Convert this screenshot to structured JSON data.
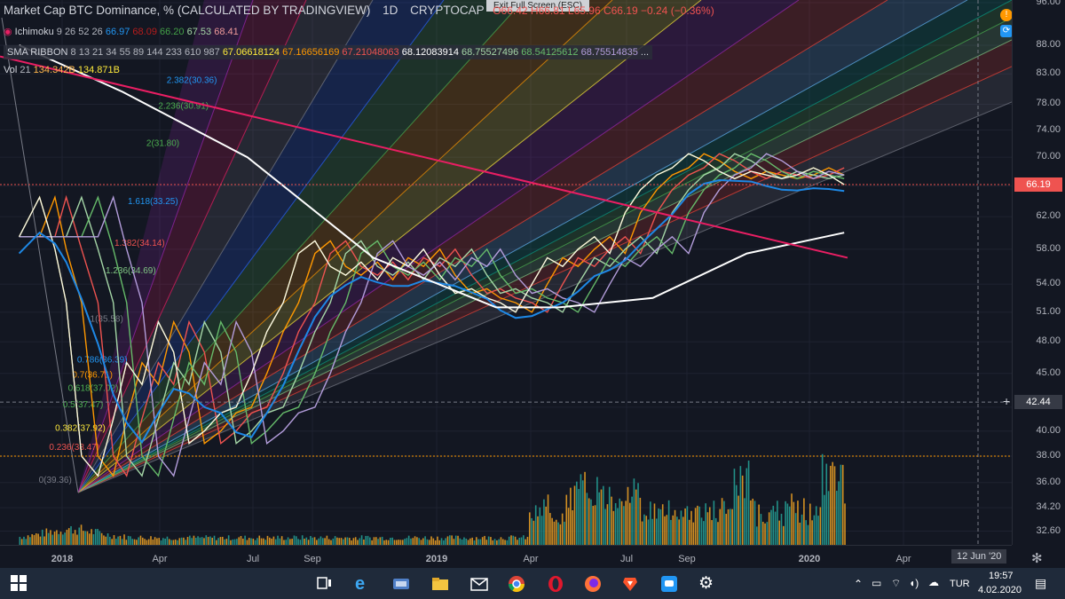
{
  "header": {
    "title": "Market Cap BTC Dominance, % (CALCULATED BY TRADINGVIEW)",
    "interval": "1D",
    "source": "CRYPTOCAP",
    "ohlc": "O66.42 H66.81 L65.96 C66.19 −0.24 (−0.36%)",
    "fullscreen_tip": "Exit Full Screen (ESC)"
  },
  "indicators": {
    "ichimoku_name": "Ichimoku",
    "ichimoku_params": "9 26 52 26",
    "ichimoku_values": [
      "66.97",
      "68.09",
      "66.20",
      "67.53",
      "68.41"
    ],
    "sma_name": "SMA RIBBON",
    "sma_params": "8 13 21 34 55 89 144 233 610 987",
    "sma_values": [
      "67.06618124",
      "67.16656169",
      "67.21048063",
      "68.12083914",
      "68.75527496",
      "68.54125612",
      "68.75514835"
    ],
    "sma_more": "...",
    "vol_name": "Vol",
    "vol_param": "21",
    "vol_values": [
      "134.342B",
      "134.871B"
    ]
  },
  "fib_labels": [
    {
      "text": "2.382(30.36)",
      "price": 81.5
    },
    {
      "text": "2.236(30.91)",
      "price": 77.3
    },
    {
      "text": "2(31.80)",
      "price": 71.6
    },
    {
      "text": "1.618(33.25)",
      "price": 63.6
    },
    {
      "text": "1.382(34.14)",
      "price": 58.4
    },
    {
      "text": "1.236(34.69)",
      "price": 55.2
    },
    {
      "text": "1(35.58)",
      "price": 50.0
    },
    {
      "text": "0.786(36.39)",
      "price": 46.0
    },
    {
      "text": "0.7(36.71)",
      "price": 44.6
    },
    {
      "text": "0.618(37.02)",
      "price": 43.4
    },
    {
      "text": "0.5(37.47)",
      "price": 42.0
    },
    {
      "text": "0.382(37.92)",
      "price": 40.0
    },
    {
      "text": "0.236(38.47)",
      "price": 38.5
    },
    {
      "text": "0(39.36)",
      "price": 36.0
    }
  ],
  "price_axis": {
    "ticks": [
      "96.00",
      "88.00",
      "83.00",
      "78.00",
      "74.00",
      "70.00",
      "66.00",
      "62.00",
      "58.00",
      "54.00",
      "51.00",
      "48.00",
      "45.00",
      "42.00",
      "40.00",
      "38.00",
      "36.00",
      "34.20",
      "32.60"
    ],
    "last_price": "66.19",
    "crosshair_price": "42.44",
    "last_color": "#ef5350",
    "crosshair_color": "#363a45"
  },
  "time_axis": {
    "ticks": [
      "2018",
      "Apr",
      "Jul",
      "Sep",
      "2019",
      "Apr",
      "Jul",
      "Sep",
      "2020",
      "Apr"
    ],
    "crosshair_date": "12 Jun '20"
  },
  "chart_data": {
    "type": "line",
    "title": "Market Cap BTC Dominance, % (CALCULATED BY TRADINGVIEW)",
    "x": [
      "2017-11-20",
      "2017-12-10",
      "2017-12-25",
      "2018-01-05",
      "2018-01-20",
      "2018-02-05",
      "2018-02-20",
      "2018-03-05",
      "2018-03-20",
      "2018-04-05",
      "2018-04-20",
      "2018-05-05",
      "2018-05-20",
      "2018-06-05",
      "2018-06-20",
      "2018-07-05",
      "2018-07-20",
      "2018-08-05",
      "2018-08-20",
      "2018-09-05",
      "2018-09-20",
      "2018-10-05",
      "2018-10-20",
      "2018-11-05",
      "2018-11-20",
      "2018-12-05",
      "2018-12-20",
      "2019-01-05",
      "2019-01-20",
      "2019-02-05",
      "2019-02-20",
      "2019-03-05",
      "2019-03-20",
      "2019-04-05",
      "2019-04-20",
      "2019-05-05",
      "2019-05-20",
      "2019-06-05",
      "2019-06-20",
      "2019-07-05",
      "2019-07-20",
      "2019-08-05",
      "2019-08-20",
      "2019-09-05",
      "2019-09-20",
      "2019-10-05",
      "2019-10-20",
      "2019-11-05",
      "2019-11-20",
      "2019-12-05",
      "2019-12-20",
      "2020-01-05",
      "2020-01-20",
      "2020-02-04"
    ],
    "series": [
      {
        "name": "BTC Dominance",
        "values": [
          59.5,
          64.5,
          58.0,
          52.0,
          38.0,
          36.5,
          41.0,
          46.0,
          44.0,
          50.0,
          47.0,
          39.0,
          40.0,
          41.5,
          42.0,
          45.0,
          49.0,
          52.0,
          57.5,
          59.0,
          56.0,
          55.0,
          56.5,
          54.5,
          57.0,
          56.0,
          58.0,
          55.0,
          53.0,
          53.5,
          52.5,
          52.0,
          51.0,
          54.0,
          57.0,
          56.0,
          58.0,
          59.5,
          57.5,
          62.5,
          65.5,
          67.5,
          68.5,
          70.5,
          69.5,
          68.0,
          67.0,
          68.0,
          67.5,
          67.0,
          67.5,
          68.5,
          67.5,
          66.19
        ]
      }
    ],
    "ma_200": {
      "x": [
        "2017-11-20",
        "2018-03-01",
        "2018-07-01",
        "2018-11-01",
        "2019-03-01",
        "2019-05-01",
        "2019-08-01",
        "2019-11-01",
        "2020-02-04"
      ],
      "values": [
        88.0,
        80.0,
        70.0,
        57.0,
        51.5,
        51.5,
        52.5,
        57.5,
        60.0
      ]
    },
    "ylim": [
      32.0,
      96.0
    ],
    "y_scale": "log",
    "legend": "top-left",
    "grid": true
  }
}
